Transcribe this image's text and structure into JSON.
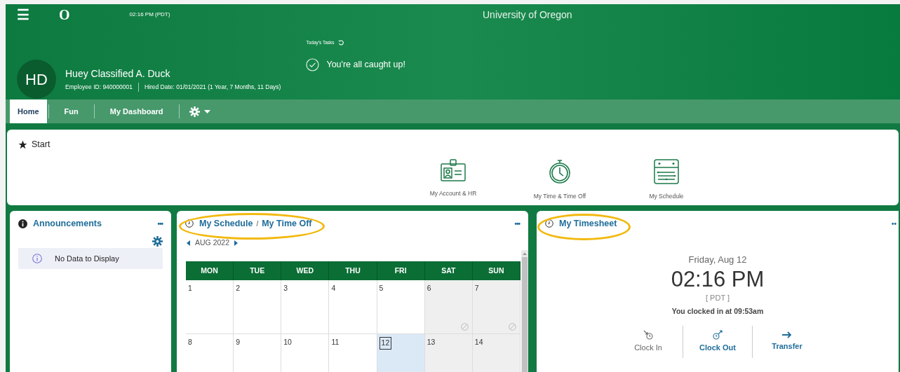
{
  "header": {
    "menu_glyph": "☰",
    "logo": "O",
    "time": "02:16 PM (PDT)",
    "title": "University of Oregon"
  },
  "profile": {
    "initials": "HD",
    "name": "Huey Classified A. Duck",
    "employee_id": "Employee ID: 940000001",
    "hired": "Hired Date: 01/01/2021 (1 Year, 7 Months, 11 Days)"
  },
  "tasks": {
    "label": "Today's Tasks",
    "message": "You're all caught up!"
  },
  "tabs": [
    {
      "label": "Home",
      "selected": true
    },
    {
      "label": "Fun",
      "selected": false
    },
    {
      "label": "My Dashboard",
      "selected": false
    }
  ],
  "start": {
    "title": "Start",
    "shortcuts": [
      {
        "label": "My Account & HR",
        "kind": "badge"
      },
      {
        "label": "My Time & Time Off",
        "kind": "stopwatch"
      },
      {
        "label": "My Schedule",
        "kind": "calendar"
      }
    ]
  },
  "announcements": {
    "title": "Announcements",
    "circled": false,
    "menu": "•••",
    "empty": "No Data to Display"
  },
  "schedule": {
    "title": "My Schedule",
    "separator": "/",
    "title_2": "My Time Off",
    "circled": true,
    "menu": "•••",
    "month": "AUG 2022",
    "weekdays": [
      "MON",
      "TUE",
      "WED",
      "THU",
      "FRI",
      "SAT",
      "SUN"
    ],
    "days": [
      {
        "label": "1",
        "today": false,
        "weekend": false,
        "unavailable": false
      },
      {
        "label": "2",
        "today": false,
        "weekend": false,
        "unavailable": false
      },
      {
        "label": "3",
        "today": false,
        "weekend": false,
        "unavailable": false
      },
      {
        "label": "4",
        "today": false,
        "weekend": false,
        "unavailable": false
      },
      {
        "label": "5",
        "today": false,
        "weekend": false,
        "unavailable": false
      },
      {
        "label": "6",
        "today": false,
        "weekend": true,
        "unavailable": true
      },
      {
        "label": "7",
        "today": false,
        "weekend": true,
        "unavailable": true
      },
      {
        "label": "8",
        "today": false,
        "weekend": false,
        "unavailable": false
      },
      {
        "label": "9",
        "today": false,
        "weekend": false,
        "unavailable": false
      },
      {
        "label": "10",
        "today": false,
        "weekend": false,
        "unavailable": false
      },
      {
        "label": "11",
        "today": false,
        "weekend": false,
        "unavailable": false
      },
      {
        "label": "12",
        "today": true,
        "weekend": false,
        "unavailable": false
      },
      {
        "label": "13",
        "today": false,
        "weekend": true,
        "unavailable": false
      },
      {
        "label": "14",
        "today": false,
        "weekend": true,
        "unavailable": false
      }
    ]
  },
  "timesheet": {
    "title": "My Timesheet",
    "circled": true,
    "menu": "••",
    "date": "Friday, Aug 12",
    "time": "02:16 PM",
    "zone": "[ PDT ]",
    "status": "You clocked in at 09:53am",
    "actions": [
      {
        "label": "Clock In",
        "kind": "clock_in",
        "disabled": true
      },
      {
        "label": "Clock Out",
        "kind": "clock_out",
        "disabled": false
      },
      {
        "label": "Transfer",
        "kind": "transfer",
        "disabled": false
      }
    ]
  }
}
